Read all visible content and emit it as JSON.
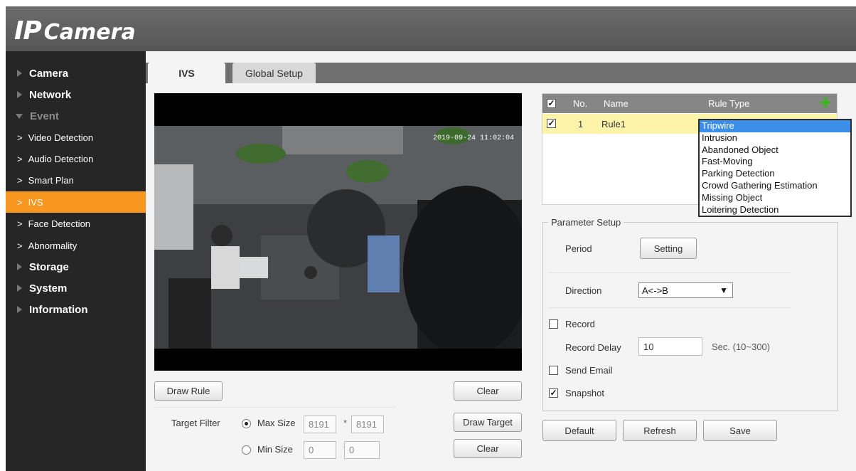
{
  "header": {
    "logo_big": "IP",
    "logo_small": "Camera"
  },
  "sidebar": {
    "camera": "Camera",
    "network": "Network",
    "event": "Event",
    "video_detection": "Video Detection",
    "audio_detection": "Audio Detection",
    "smart_plan": "Smart Plan",
    "ivs": "IVS",
    "face_detection": "Face Detection",
    "abnormality": "Abnormality",
    "storage": "Storage",
    "system": "System",
    "information": "Information"
  },
  "tabs": {
    "ivs": "IVS",
    "global_setup": "Global Setup"
  },
  "video": {
    "timestamp": "2019-09-24 11:02:04"
  },
  "left_controls": {
    "draw_rule": "Draw Rule",
    "clear": "Clear",
    "target_filter": "Target Filter",
    "max_size": "Max Size",
    "max_w": "8191",
    "max_h": "8191",
    "min_size": "Min Size",
    "min_w": "0",
    "min_h": "0",
    "times": "*",
    "draw_target": "Draw Target",
    "clear2": "Clear"
  },
  "rule_table": {
    "headers": {
      "no": "No.",
      "name": "Name",
      "rule_type": "Rule Type"
    },
    "row": {
      "no": "1",
      "name": "Rule1"
    }
  },
  "rule_type_options": [
    "Tripwire",
    "Intrusion",
    "Abandoned Object",
    "Fast-Moving",
    "Parking Detection",
    "Crowd Gathering Estimation",
    "Missing Object",
    "Loitering Detection"
  ],
  "params": {
    "legend": "Parameter Setup",
    "period": "Period",
    "setting": "Setting",
    "direction": "Direction",
    "direction_value": "A<->B",
    "record": "Record",
    "record_delay": "Record Delay",
    "record_delay_value": "10",
    "delay_hint": "Sec. (10~300)",
    "send_email": "Send Email",
    "snapshot": "Snapshot"
  },
  "actions": {
    "default": "Default",
    "refresh": "Refresh",
    "save": "Save"
  },
  "colors": {
    "accent": "#f7971f",
    "sidebar": "#262626",
    "selected_row": "#fdf3a9",
    "dropdown_highlight": "#3d8ee8"
  }
}
